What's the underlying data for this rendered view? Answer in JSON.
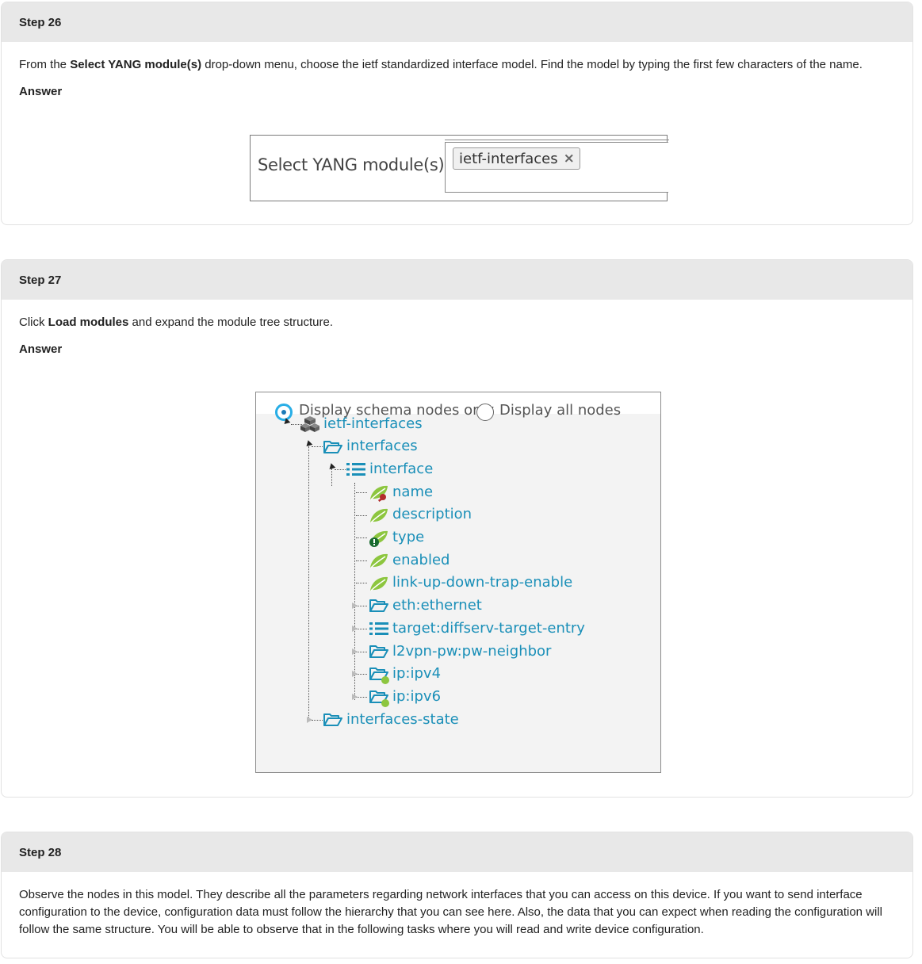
{
  "step26": {
    "title": "Step 26",
    "text_pre": "From the ",
    "text_bold": "Select YANG module(s)",
    "text_post": " drop-down menu, choose the ietf standardized interface model. Find the model by typing the first few characters of the name.",
    "answer_label": "Answer",
    "select_label": "Select YANG module(s)",
    "selected_tag": "ietf-interfaces",
    "tag_remove": "×"
  },
  "step27": {
    "title": "Step 27",
    "text_pre": "Click ",
    "text_bold": "Load modules",
    "text_post": " and expand the module tree structure.",
    "answer_label": "Answer",
    "radio_schema": "Display schema nodes only",
    "radio_all": "Display all nodes",
    "tree": {
      "root": "ietf-interfaces",
      "interfaces": "interfaces",
      "interface": "interface",
      "name": "name",
      "description": "description",
      "type": "type",
      "enabled": "enabled",
      "link": "link-up-down-trap-enable",
      "eth": "eth:ethernet",
      "target": "target:diffserv-target-entry",
      "l2vpn": "l2vpn-pw:pw-neighbor",
      "ipv4": "ip:ipv4",
      "ipv6": "ip:ipv6",
      "state": "interfaces-state"
    }
  },
  "step28": {
    "title": "Step 28",
    "text": "Observe the nodes in this model. They describe all the parameters regarding network interfaces that you can access on this device. If you want to send interface configuration to the device, configuration data must follow the hierarchy that you can see here. Also, the data that you can expect when reading the configuration will follow the same structure. You will be able to observe that in the following tasks where you will read and write device configuration."
  },
  "colors": {
    "header_bg": "#e8e8e8",
    "tree_link": "#1a8fb8",
    "radio_accent": "#29aee6",
    "leaf_green": "#8dc63f"
  }
}
